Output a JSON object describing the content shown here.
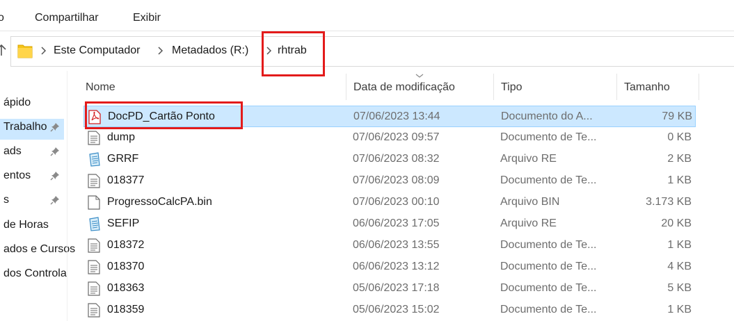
{
  "ribbon": {
    "items": [
      "o",
      "Compartilhar",
      "Exibir"
    ]
  },
  "address": {
    "crumbs": [
      "Este Computador",
      "Metadados (R:)",
      "rhtrab"
    ]
  },
  "nav": {
    "items": [
      {
        "label": "ápido",
        "pinned": false,
        "selected": false
      },
      {
        "label": "Trabalho",
        "pinned": true,
        "selected": true
      },
      {
        "label": "ads",
        "pinned": true,
        "selected": false
      },
      {
        "label": "entos",
        "pinned": true,
        "selected": false
      },
      {
        "label": "s",
        "pinned": true,
        "selected": false
      },
      {
        "label": "de Horas",
        "pinned": false,
        "selected": false
      },
      {
        "label": "ados e Cursos",
        "pinned": false,
        "selected": false
      },
      {
        "label": "dos Controla",
        "pinned": false,
        "selected": false
      }
    ]
  },
  "columns": {
    "name": "Nome",
    "date": "Data de modificação",
    "type": "Tipo",
    "size": "Tamanho"
  },
  "files": [
    {
      "name": "DocPD_Cartão Ponto",
      "date": "07/06/2023 13:44",
      "type": "Documento do A...",
      "size": "79 KB",
      "icon": "pdf-icon",
      "selected": true
    },
    {
      "name": "dump",
      "date": "07/06/2023 09:57",
      "type": "Documento de Te...",
      "size": "0 KB",
      "icon": "text-file-icon",
      "selected": false
    },
    {
      "name": "GRRF",
      "date": "07/06/2023 08:32",
      "type": "Arquivo RE",
      "size": "2 KB",
      "icon": "notepad-icon",
      "selected": false
    },
    {
      "name": "018377",
      "date": "07/06/2023 08:09",
      "type": "Documento de Te...",
      "size": "1 KB",
      "icon": "text-file-icon",
      "selected": false
    },
    {
      "name": "ProgressoCalcPA.bin",
      "date": "07/06/2023 00:10",
      "type": "Arquivo BIN",
      "size": "3.173 KB",
      "icon": "blank-file-icon",
      "selected": false
    },
    {
      "name": "SEFIP",
      "date": "06/06/2023 17:05",
      "type": "Arquivo RE",
      "size": "20 KB",
      "icon": "notepad-icon",
      "selected": false
    },
    {
      "name": "018372",
      "date": "06/06/2023 13:55",
      "type": "Documento de Te...",
      "size": "1 KB",
      "icon": "text-file-icon",
      "selected": false
    },
    {
      "name": "018370",
      "date": "06/06/2023 13:12",
      "type": "Documento de Te...",
      "size": "4 KB",
      "icon": "text-file-icon",
      "selected": false
    },
    {
      "name": "018363",
      "date": "05/06/2023 17:18",
      "type": "Documento de Te...",
      "size": "5 KB",
      "icon": "text-file-icon",
      "selected": false
    },
    {
      "name": "018359",
      "date": "05/06/2023 15:02",
      "type": "Documento de Te...",
      "size": "1 KB",
      "icon": "text-file-icon",
      "selected": false
    }
  ],
  "colors": {
    "highlight_box": "#e31b1b",
    "selection_bg": "#cce8ff",
    "selection_border": "#99d1ff",
    "pdf_red": "#d42020",
    "folder_yellow": "#f5c518"
  }
}
